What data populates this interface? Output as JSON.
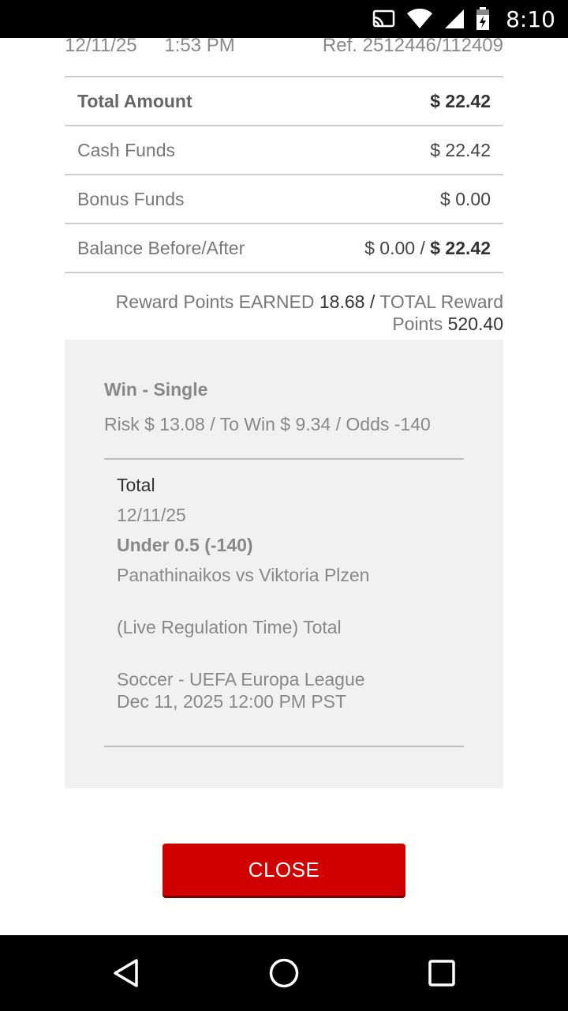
{
  "status_bar": {
    "time": "8:10",
    "icons": [
      "cast-icon",
      "wifi-icon",
      "signal-icon",
      "battery-icon"
    ]
  },
  "receipt": {
    "date": "12/11/25",
    "time": "1:53 PM",
    "ref": "Ref. 2512446/112409",
    "rows": {
      "total_label": "Total Amount",
      "total_value": "$ 22.42",
      "cash_label": "Cash Funds",
      "cash_value": "$ 22.42",
      "bonus_label": "Bonus Funds",
      "bonus_value": "$ 0.00",
      "balance_label": "Balance Before/After",
      "balance_before": "$ 0.00 /",
      "balance_after": "$ 22.42"
    },
    "reward": {
      "earned_label": "Reward Points EARNED",
      "earned_value": "18.68",
      "sep": "/",
      "total_label": "TOTAL Reward Points",
      "total_value": "520.40"
    }
  },
  "bet": {
    "type": "Win - Single",
    "summary": "Risk $ 13.08 / To Win $ 9.34 / Odds -140",
    "selection": {
      "market": "Total",
      "date": "12/11/25",
      "pick": "Under 0.5 (-140)",
      "event": "Panathinaikos vs Viktoria Plzen",
      "period": "(Live Regulation Time) Total",
      "league": "Soccer - UEFA Europa League Dec 11, 2025 12:00 PM PST"
    }
  },
  "actions": {
    "close_label": "CLOSE"
  },
  "nav": {
    "icons": [
      "back-icon",
      "home-icon",
      "recents-icon"
    ]
  }
}
